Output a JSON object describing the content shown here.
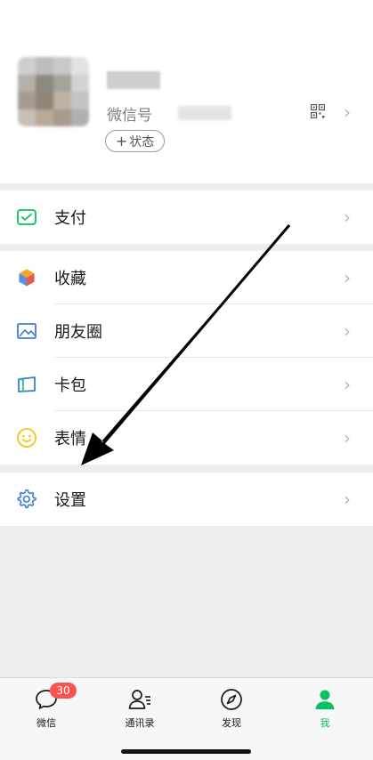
{
  "profile": {
    "wechat_id_label": "微信号",
    "status_label": "状态",
    "status_plus": "+",
    "chevron": "›"
  },
  "menu": {
    "pay": {
      "label": "支付",
      "icon": "wallet-icon"
    },
    "favorites": {
      "label": "收藏",
      "icon": "cube-icon"
    },
    "moments": {
      "label": "朋友圈",
      "icon": "photo-icon"
    },
    "cards": {
      "label": "卡包",
      "icon": "card-icon"
    },
    "stickers": {
      "label": "表情",
      "icon": "smiley-icon"
    },
    "settings": {
      "label": "设置",
      "icon": "gear-icon"
    },
    "chevron": "›"
  },
  "tabbar": {
    "chats": {
      "label": "微信",
      "badge": "30",
      "icon": "chat-bubble-icon"
    },
    "contacts": {
      "label": "通讯录",
      "icon": "contacts-icon"
    },
    "discover": {
      "label": "发现",
      "icon": "compass-icon"
    },
    "me": {
      "label": "我",
      "icon": "person-icon",
      "active": true
    }
  },
  "colors": {
    "accent_green": "#07c160",
    "badge_red": "#fa5151",
    "background": "#ededed",
    "annotation_arrow": "#000000"
  }
}
